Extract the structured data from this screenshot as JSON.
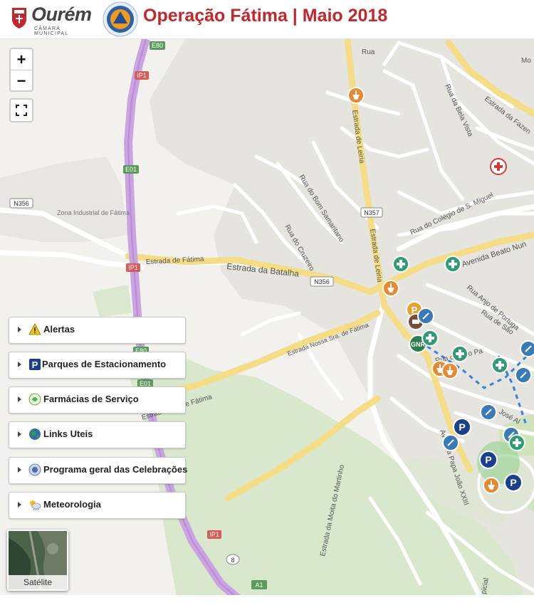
{
  "header": {
    "brand_name": "Ourém",
    "brand_sub": "CÂMARA MUNICIPAL",
    "title": "Operação Fátima | Maio 2018",
    "title_color": "#c1272d"
  },
  "controls": {
    "zoom_in": "+",
    "zoom_out": "−",
    "fullscreen_icon": "fullscreen-icon"
  },
  "layers": [
    {
      "label": "Alertas",
      "icon": "warning-icon"
    },
    {
      "label": "Parques de Estacionamento",
      "icon": "parking-icon"
    },
    {
      "label": "Farmácias de Serviço",
      "icon": "pharmacy-icon"
    },
    {
      "label": "Links Uteis",
      "icon": "globe-icon"
    },
    {
      "label": "Programa geral das Celebrações",
      "icon": "program-icon"
    },
    {
      "label": "Meteorologia",
      "icon": "weather-icon"
    }
  ],
  "satellite": {
    "label": "Satélite"
  },
  "map_labels": {
    "e80_top": "E80",
    "ip1_top": "IP1",
    "rua_top": "Rua",
    "mo": "Mo",
    "rua_bela_vista": "Rua da Bela Vista",
    "estrada_fazen": "Estrada da Fazen",
    "estrada_leiria_top": "Estrada de Leiria",
    "e01_top": "E01",
    "rua_bom_samaritano": "Rua do Bom Samaritano",
    "n357": "N357",
    "rua_colegio": "Rua do Colégio de S. Miguel",
    "n356_left": "N356",
    "zona_industrial": "Zona Industrial de Fátima",
    "rua_cruzeiro": "Rua do Cruzeiro",
    "estrada_leiria_mid": "Estrada de Leiria",
    "avenida_beato": "Avenida Beato Nun",
    "ip1_mid": "IP1",
    "estrada_fatima": "Estrada de Fátima",
    "estrada_batalha": "Estrada da Batalha",
    "n356_mid": "N356",
    "rua_anjo": "Rua Anjo de Portuga",
    "rua_sao": "Rua de São",
    "e80_mid": "E80",
    "estrada_nossa_sra": "Estrada Nossa Sra. de Fátima",
    "rua_sao_pa": "Rua de São Pa",
    "e01_mid": "E01",
    "estrada_sra_fatima": "Estrada Sra. de Fátima",
    "rua_jose": "José Al",
    "avenida_papa": "Avenida Papa João XXIII",
    "estrada_mota": "Estrada da Moita do Martinho",
    "ip1_bottom": "IP1",
    "route_8": "8",
    "a1": "A1",
    "pical": "picial"
  },
  "markers": [
    {
      "kind": "pharmacy",
      "label": "",
      "color": "#e8892f"
    },
    {
      "kind": "hospital",
      "label": "",
      "color": "#d33a3a"
    },
    {
      "kind": "first-aid",
      "label": "",
      "color": "#2e9b73"
    },
    {
      "kind": "first-aid",
      "label": "",
      "color": "#2e9b73"
    },
    {
      "kind": "pharmacy",
      "label": "",
      "color": "#e8892f"
    },
    {
      "kind": "parking",
      "label": "P",
      "color": "#e8a12f"
    },
    {
      "kind": "police",
      "label": "",
      "color": "#7a4a3a"
    },
    {
      "kind": "gnr",
      "label": "GNR",
      "color": "#2e7d4f"
    },
    {
      "kind": "first-aid",
      "label": "",
      "color": "#2e9b73"
    },
    {
      "kind": "first-aid",
      "label": "",
      "color": "#2e9b73"
    },
    {
      "kind": "parking",
      "label": "P",
      "color": "#1c3f8c"
    },
    {
      "kind": "parking",
      "label": "P",
      "color": "#1c3f8c"
    },
    {
      "kind": "parking",
      "label": "P",
      "color": "#1c3f8c"
    },
    {
      "kind": "accessibility",
      "label": "",
      "color": "#3a7ab8"
    },
    {
      "kind": "pharmacy",
      "label": "",
      "color": "#e8892f"
    }
  ]
}
